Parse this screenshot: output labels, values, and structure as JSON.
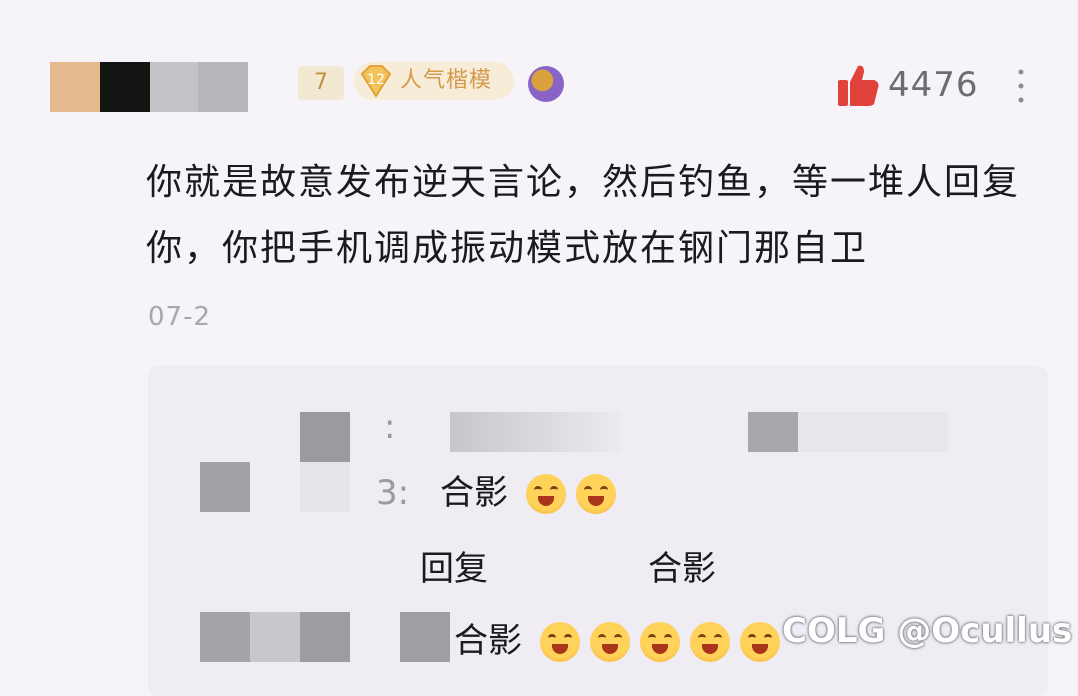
{
  "comment": {
    "user_level": "7",
    "rank_level": "12",
    "rank_label": "人气楷模",
    "like_count": "4476",
    "text": "你就是故意发布逆天言论，然后钓鱼，等一堆人回复你，你把手机调成振动模式放在钢门那自卫",
    "date": "07-2"
  },
  "replies": [
    {
      "separator": ":"
    },
    {
      "prefix": "3:",
      "text": "合影"
    },
    {
      "reply_label": "回复",
      "text": "合影"
    },
    {
      "text": "合影"
    }
  ],
  "watermark": "COLG @Ocullus",
  "colors": {
    "background": "#f6f3f9",
    "like_icon": "#e2423c",
    "reply_bg": "#efecf3"
  }
}
